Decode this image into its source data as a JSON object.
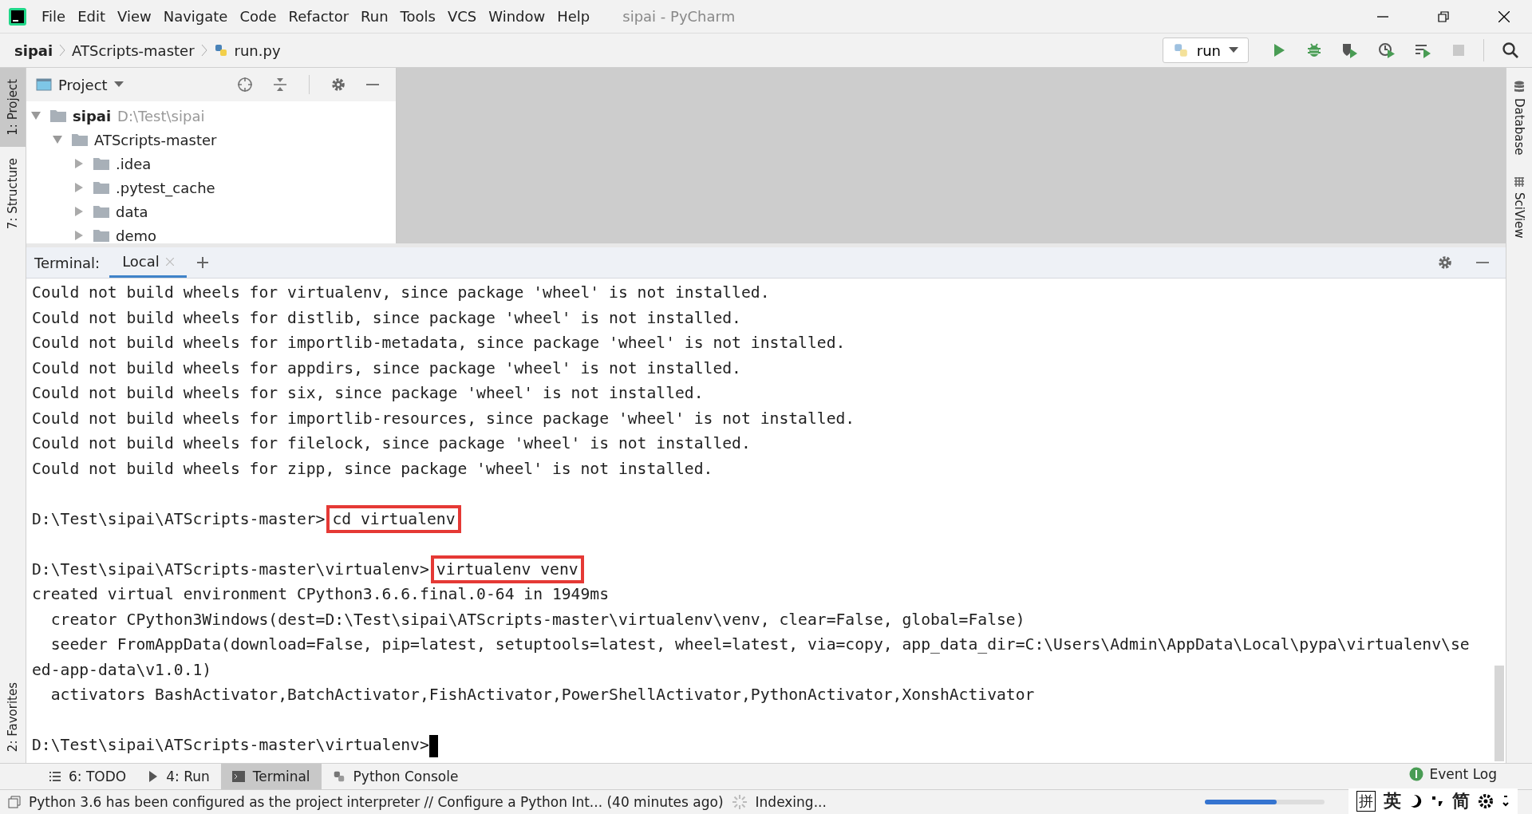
{
  "window": {
    "title": "sipai - PyCharm"
  },
  "menu": [
    "File",
    "Edit",
    "View",
    "Navigate",
    "Code",
    "Refactor",
    "Run",
    "Tools",
    "VCS",
    "Window",
    "Help"
  ],
  "breadcrumb": [
    {
      "label": "sipai",
      "bold": true
    },
    {
      "label": "ATScripts-master",
      "bold": false
    },
    {
      "label": "run.py",
      "bold": false
    }
  ],
  "run_config": {
    "label": "run"
  },
  "left_tool_tabs": [
    {
      "label": "1: Project",
      "selected": true
    },
    {
      "label": "7: Structure",
      "selected": false
    }
  ],
  "left_bottom_tool_tabs": [
    {
      "label": "2: Favorites",
      "selected": false
    }
  ],
  "right_tool_tabs": [
    {
      "label": "Database"
    },
    {
      "label": "SciView"
    }
  ],
  "project": {
    "title": "Project",
    "tree": [
      {
        "name": "sipai",
        "path": "D:\\Test\\sipai",
        "expanded": true,
        "children": [
          {
            "name": "ATScripts-master",
            "expanded": true,
            "children": [
              {
                "name": ".idea",
                "expanded": false
              },
              {
                "name": ".pytest_cache",
                "expanded": false
              },
              {
                "name": "data",
                "expanded": false
              },
              {
                "name": "demo",
                "expanded": false
              }
            ]
          }
        ]
      }
    ]
  },
  "terminal": {
    "label": "Terminal:",
    "tabs": [
      {
        "label": "Local",
        "selected": true
      }
    ],
    "lines": [
      {
        "kind": "output",
        "text": "Could not build wheels for virtualenv, since package 'wheel' is not installed."
      },
      {
        "kind": "output",
        "text": "Could not build wheels for distlib, since package 'wheel' is not installed."
      },
      {
        "kind": "output",
        "text": "Could not build wheels for importlib-metadata, since package 'wheel' is not installed."
      },
      {
        "kind": "output",
        "text": "Could not build wheels for appdirs, since package 'wheel' is not installed."
      },
      {
        "kind": "output",
        "text": "Could not build wheels for six, since package 'wheel' is not installed."
      },
      {
        "kind": "output",
        "text": "Could not build wheels for importlib-resources, since package 'wheel' is not installed."
      },
      {
        "kind": "output",
        "text": "Could not build wheels for filelock, since package 'wheel' is not installed."
      },
      {
        "kind": "output",
        "text": "Could not build wheels for zipp, since package 'wheel' is not installed."
      },
      {
        "kind": "blank"
      },
      {
        "kind": "prompt",
        "prompt": "D:\\Test\\sipai\\ATScripts-master>",
        "command": "cd virtualenv",
        "highlighted": true
      },
      {
        "kind": "blank"
      },
      {
        "kind": "prompt",
        "prompt": "D:\\Test\\sipai\\ATScripts-master\\virtualenv>",
        "command": "virtualenv venv",
        "highlighted": true
      },
      {
        "kind": "output",
        "text": "created virtual environment CPython3.6.6.final.0-64 in 1949ms"
      },
      {
        "kind": "output",
        "text": "  creator CPython3Windows(dest=D:\\Test\\sipai\\ATScripts-master\\virtualenv\\venv, clear=False, global=False)"
      },
      {
        "kind": "output",
        "text": "  seeder FromAppData(download=False, pip=latest, setuptools=latest, wheel=latest, via=copy, app_data_dir=C:\\Users\\Admin\\AppData\\Local\\pypa\\virtualenv\\se"
      },
      {
        "kind": "output",
        "text": "ed-app-data\\v1.0.1)"
      },
      {
        "kind": "output",
        "text": "  activators BashActivator,BatchActivator,FishActivator,PowerShellActivator,PythonActivator,XonshActivator"
      },
      {
        "kind": "blank"
      },
      {
        "kind": "prompt",
        "prompt": "D:\\Test\\sipai\\ATScripts-master\\virtualenv>",
        "cursor": true
      }
    ]
  },
  "bottom_tabs": [
    {
      "label": "6: TODO",
      "kind": "list",
      "selected": false
    },
    {
      "label": "4: Run",
      "kind": "run",
      "selected": false
    },
    {
      "label": "Terminal",
      "kind": "terminal",
      "selected": true
    },
    {
      "label": "Python Console",
      "kind": "python",
      "selected": false
    }
  ],
  "event_log": {
    "label": "Event Log"
  },
  "status_bar": {
    "message": "Python 3.6 has been configured as the project interpreter // Configure a Python Int... (40 minutes ago)",
    "task": "Indexing...",
    "level": 0.6
  },
  "ime_toolbar": [
    "拼",
    "英",
    "简"
  ]
}
